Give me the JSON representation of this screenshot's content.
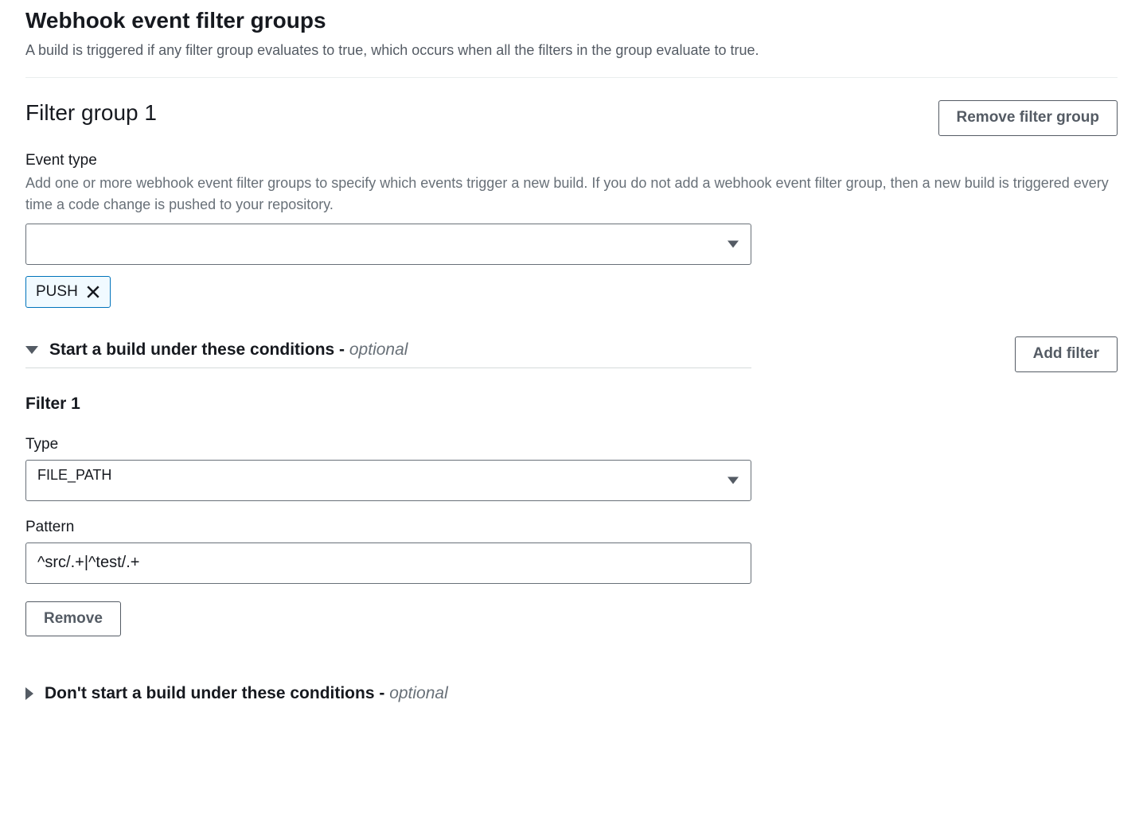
{
  "page": {
    "title": "Webhook event filter groups",
    "description": "A build is triggered if any filter group evaluates to true, which occurs when all the filters in the group evaluate to true."
  },
  "group": {
    "title": "Filter group 1",
    "remove_label": "Remove filter group",
    "event_type": {
      "label": "Event type",
      "description": "Add one or more webhook event filter groups to specify which events trigger a new build. If you do not add a webhook event filter group, then a new build is triggered every time a code change is pushed to your repository.",
      "selected_value": "",
      "tags": [
        "PUSH"
      ]
    },
    "conditions_start": {
      "title": "Start a build under these conditions",
      "optional_suffix": "optional",
      "add_filter_label": "Add filter",
      "filters": [
        {
          "title": "Filter 1",
          "type_label": "Type",
          "type_value": "FILE_PATH",
          "pattern_label": "Pattern",
          "pattern_value": "^src/.+|^test/.+",
          "remove_label": "Remove"
        }
      ]
    },
    "conditions_dont_start": {
      "title": "Don't start a build under these conditions",
      "optional_suffix": "optional"
    }
  }
}
